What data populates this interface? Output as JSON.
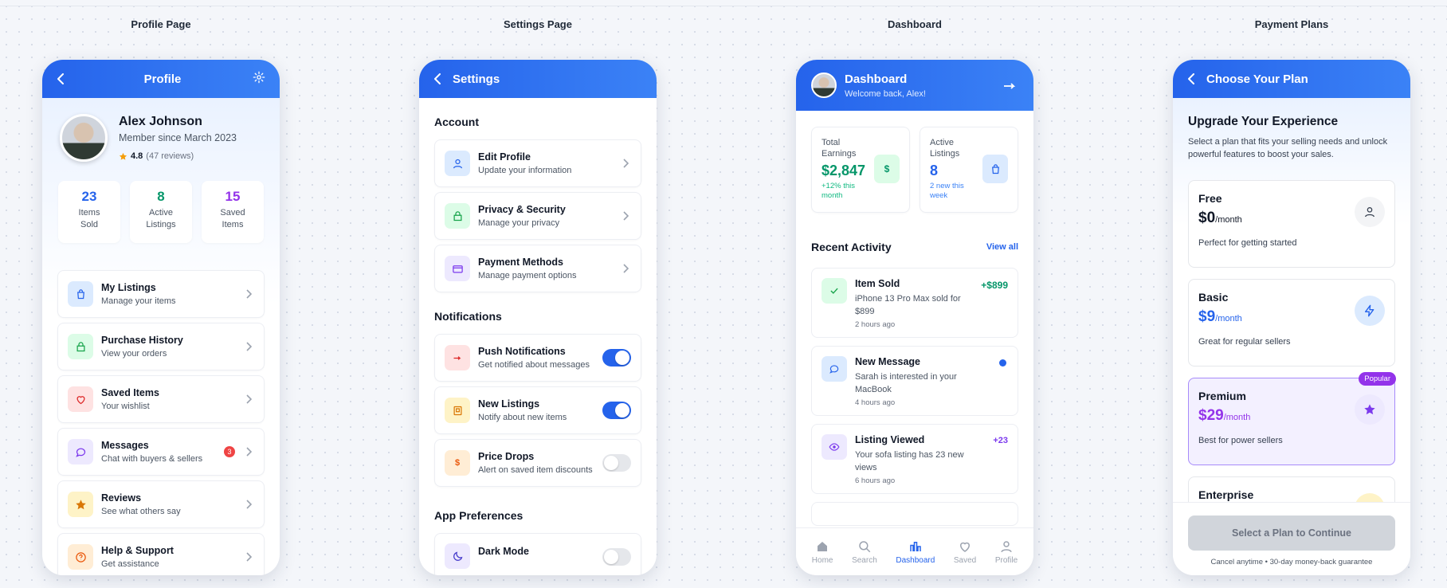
{
  "screens": {
    "profile": "Profile Page",
    "settings": "Settings Page",
    "dashboard": "Dashboard",
    "payment": "Payment Plans"
  },
  "profile": {
    "title": "Profile",
    "name": "Alex Johnson",
    "member_since": "Member since March 2023",
    "rating": "4.8",
    "reviews": "(47 reviews)",
    "stats": [
      {
        "value": "23",
        "label1": "Items",
        "label2": "Sold",
        "color": "#2563eb"
      },
      {
        "value": "8",
        "label1": "Active",
        "label2": "Listings",
        "color": "#059669"
      },
      {
        "value": "15",
        "label1": "Saved",
        "label2": "Items",
        "color": "#9333ea"
      }
    ],
    "menu": [
      {
        "title": "My Listings",
        "subtitle": "Manage your items",
        "icon": "shopping-bag-icon",
        "bg": "#dbeafe",
        "fg": "#2563eb"
      },
      {
        "title": "Purchase History",
        "subtitle": "View your orders",
        "icon": "lock-bag-icon",
        "bg": "#dcfce7",
        "fg": "#16a34a"
      },
      {
        "title": "Saved Items",
        "subtitle": "Your wishlist",
        "icon": "heart-icon",
        "bg": "#fee2e2",
        "fg": "#dc2626"
      },
      {
        "title": "Messages",
        "subtitle": "Chat with buyers & sellers",
        "icon": "chat-icon",
        "bg": "#ede9fe",
        "fg": "#7c3aed",
        "badge": "3"
      },
      {
        "title": "Reviews",
        "subtitle": "See what others say",
        "icon": "star-icon",
        "bg": "#fef3c7",
        "fg": "#d97706"
      },
      {
        "title": "Help & Support",
        "subtitle": "Get assistance",
        "icon": "help-icon",
        "bg": "#ffedd5",
        "fg": "#ea580c"
      }
    ]
  },
  "settings": {
    "title": "Settings",
    "account_heading": "Account",
    "account": [
      {
        "title": "Edit Profile",
        "subtitle": "Update your information",
        "icon": "user-icon",
        "bg": "#dbeafe",
        "fg": "#2563eb"
      },
      {
        "title": "Privacy & Security",
        "subtitle": "Manage your privacy",
        "icon": "lock-icon",
        "bg": "#dcfce7",
        "fg": "#16a34a"
      },
      {
        "title": "Payment Methods",
        "subtitle": "Manage payment options",
        "icon": "credit-card-icon",
        "bg": "#ede9fe",
        "fg": "#7c3aed"
      }
    ],
    "notifications_heading": "Notifications",
    "notifications": [
      {
        "title": "Push Notifications",
        "subtitle": "Get notified about messages",
        "icon": "bell-icon",
        "bg": "#fee2e2",
        "fg": "#dc2626",
        "on": true
      },
      {
        "title": "New Listings",
        "subtitle": "Notify about new items",
        "icon": "box-icon",
        "bg": "#fef3c7",
        "fg": "#d97706",
        "on": true
      },
      {
        "title": "Price Drops",
        "subtitle": "Alert on saved item discounts",
        "icon": "dollar-icon",
        "bg": "#ffedd5",
        "fg": "#ea580c",
        "on": false
      }
    ],
    "prefs_heading": "App Preferences",
    "dark_mode": "Dark Mode"
  },
  "dashboard": {
    "title": "Dashboard",
    "welcome": "Welcome back, Alex!",
    "earnings_label1": "Total",
    "earnings_label2": "Earnings",
    "earnings_value": "$2,847",
    "earnings_delta1": "+12% this",
    "earnings_delta2": "month",
    "earnings_icon_text": "$",
    "listings_label1": "Active",
    "listings_label2": "Listings",
    "listings_value": "8",
    "listings_delta1": "2 new this",
    "listings_delta2": "week",
    "recent_heading": "Recent Activity",
    "view_all": "View all",
    "activity": [
      {
        "title": "Item Sold",
        "desc": "iPhone 13 Pro Max sold for $899",
        "time": "2 hours ago",
        "amount": "+$899",
        "amount_color": "#059669",
        "icon": "check-icon",
        "bg": "#dcfce7",
        "fg": "#16a34a"
      },
      {
        "title": "New Message",
        "desc": "Sarah is interested in your MacBook",
        "time": "4 hours ago",
        "amount": "",
        "amount_color": "#2563eb",
        "icon": "chat-icon",
        "bg": "#dbeafe",
        "fg": "#2563eb"
      },
      {
        "title": "Listing Viewed",
        "desc": "Your sofa listing has 23 new views",
        "time": "6 hours ago",
        "amount": "+23",
        "amount_color": "#7c3aed",
        "icon": "eye-icon",
        "bg": "#ede9fe",
        "fg": "#7c3aed"
      }
    ],
    "nav": [
      "Home",
      "Search",
      "Dashboard",
      "Saved",
      "Profile"
    ]
  },
  "payment": {
    "title": "Choose Your Plan",
    "heading": "Upgrade Your Experience",
    "intro": "Select a plan that fits your selling needs and unlock powerful features to boost your sales.",
    "plans": [
      {
        "name": "Free",
        "price": "$0",
        "period": "/month",
        "desc": "Perfect for getting started",
        "color": "#111827",
        "icon": "user-icon",
        "icon_bg": "#f3f4f6"
      },
      {
        "name": "Basic",
        "price": "$9",
        "period": "/month",
        "desc": "Great for regular sellers",
        "color": "#2563eb",
        "icon": "lightning-icon",
        "icon_bg": "#dbeafe"
      },
      {
        "name": "Premium",
        "price": "$29",
        "period": "/month",
        "desc": "Best for power sellers",
        "color": "#9333ea",
        "icon": "star-icon",
        "icon_bg": "#ede9fe",
        "badge": "Popular"
      },
      {
        "name": "Enterprise",
        "price": "",
        "period": "",
        "desc": "",
        "color": "#111827",
        "icon": "crown-icon",
        "icon_bg": "#fef3c7"
      }
    ],
    "cta": "Select a Plan to Continue",
    "fine_print": "Cancel anytime • 30-day money-back guarantee"
  }
}
